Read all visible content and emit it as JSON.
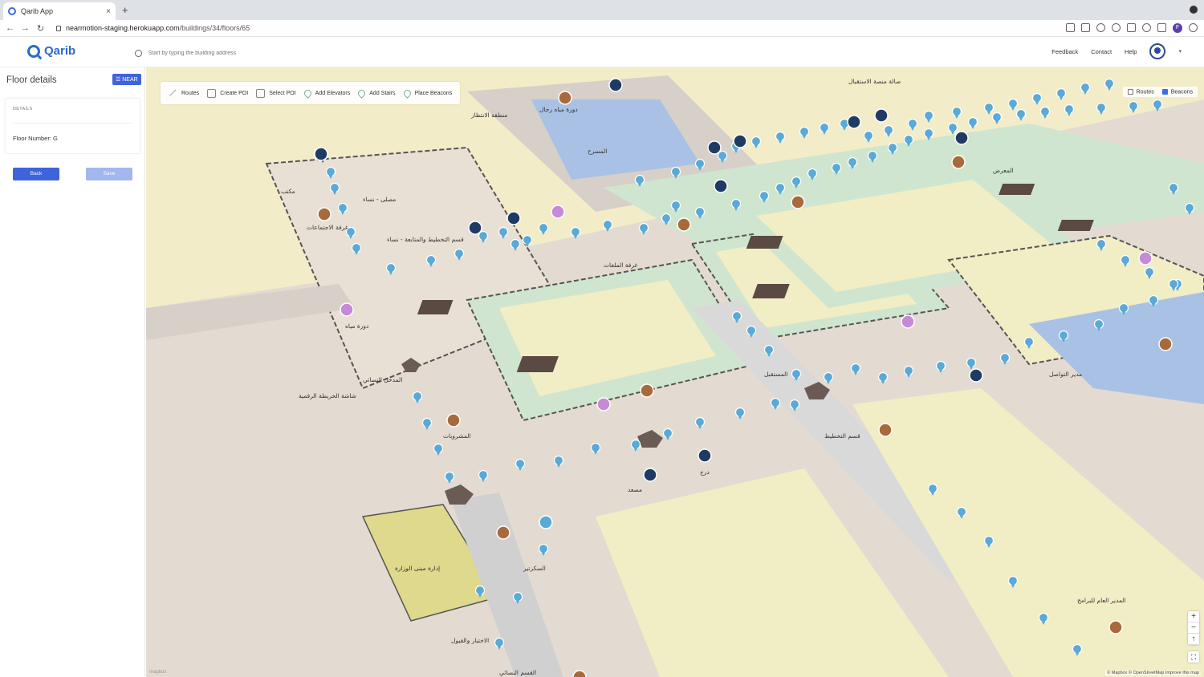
{
  "browser": {
    "tab_title": "Qarib App",
    "tab_close": "×",
    "new_tab": "+",
    "url_host": "nearmotion-staging.herokuapp.com",
    "url_path": "/buildings/34/floors/65",
    "profile_initial": "F"
  },
  "header": {
    "logo_text": "Qarib",
    "search_placeholder": "Start by typing the building address",
    "nav": [
      "Feedback",
      "Contact",
      "Help"
    ]
  },
  "sidebar": {
    "title": "Floor details",
    "near_button": "☰ NEAR",
    "details_label": "DETAILS",
    "floor_number": "Floor Number: G",
    "back_button": "Back",
    "save_button": "Save"
  },
  "toolbar": {
    "items": [
      "Routes",
      "Create POI",
      "Select POI",
      "Add Elevators",
      "Add Stairs",
      "Place Beacons"
    ]
  },
  "layers": {
    "routes_label": "Routes",
    "routes_checked": false,
    "beacons_label": "Beacons",
    "beacons_checked": true
  },
  "map": {
    "zoom_in": "+",
    "zoom_out": "−",
    "north": "↑",
    "fullscreen": "⛶",
    "attribution": "© Mapbox © OpenStreetMap Improve this map",
    "mapbox_logo": "mapbox",
    "labels": [
      "مكتب",
      "مصلى - نساء",
      "غرفة الاجتماعات",
      "قسم التخطيط والمتابعة - نساء",
      "دورة مياه",
      "المدخل النسائي",
      "شاشة الخريطة الرقمية",
      "المشروبات",
      "إدارة مبنى الوزارة",
      "الاختبار والقبول",
      "السكرتير",
      "مصعد",
      "درج",
      "المسرح",
      "دورة مياه رجال",
      "منطقة الانتظار",
      "صالة منصة الاستقبال",
      "المعرض",
      "غرفة الملفات",
      "قسم التخطيط",
      "المدير العام للبرامج",
      "مدير التواصل",
      "المستقبل",
      "القسم النسائي"
    ],
    "colors": {
      "background": "#f3ecc8",
      "corridor": "#d9cfc6",
      "room": "#e8e0d4",
      "water": "#aac2e6",
      "green": "#cde5cd",
      "highlight": "#ded98c",
      "beacon": "#5aa9d6",
      "elevator": "#1f3b63",
      "restroom": "#c68ad6",
      "drinks": "#a86a3a"
    }
  }
}
